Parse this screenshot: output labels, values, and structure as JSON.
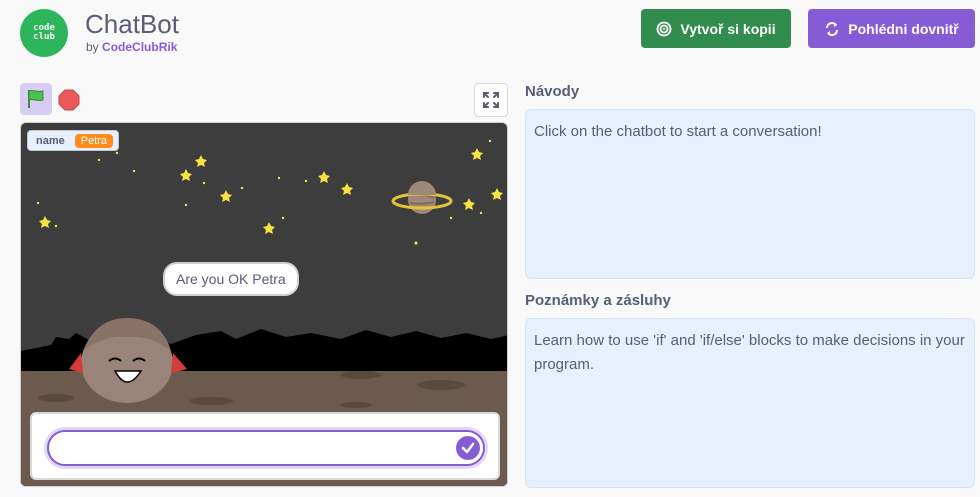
{
  "project": {
    "title": "ChatBot",
    "by_prefix": "by",
    "author": "CodeClubRik",
    "avatar_text_line1": "code",
    "avatar_text_line2": "club"
  },
  "buttons": {
    "remix_label": "Vytvoř si kopii",
    "see_inside_label": "Pohlédni dovnitř"
  },
  "stage": {
    "variable_name": "name",
    "variable_value": "Petra",
    "speech_text": "Are you OK Petra",
    "answer_value": ""
  },
  "instructions": {
    "title": "Návody",
    "text": "Click on the chatbot to start a conversation!"
  },
  "notes": {
    "title": "Poznámky a zásluhy",
    "text": "Learn how to use 'if' and 'if/else' blocks to make decisions in your program."
  },
  "colors": {
    "brand": "#2cb55a",
    "remix": "#328c4e",
    "accent": "#855cd6",
    "panel_bg": "#e6f0ff",
    "variable": "#ff8c1a"
  },
  "icons": {
    "green_flag": "green-flag-icon",
    "stop": "stop-icon",
    "fullscreen": "fullscreen-icon",
    "remix": "remix-icon",
    "see_inside": "see-inside-icon",
    "submit": "check-icon"
  }
}
